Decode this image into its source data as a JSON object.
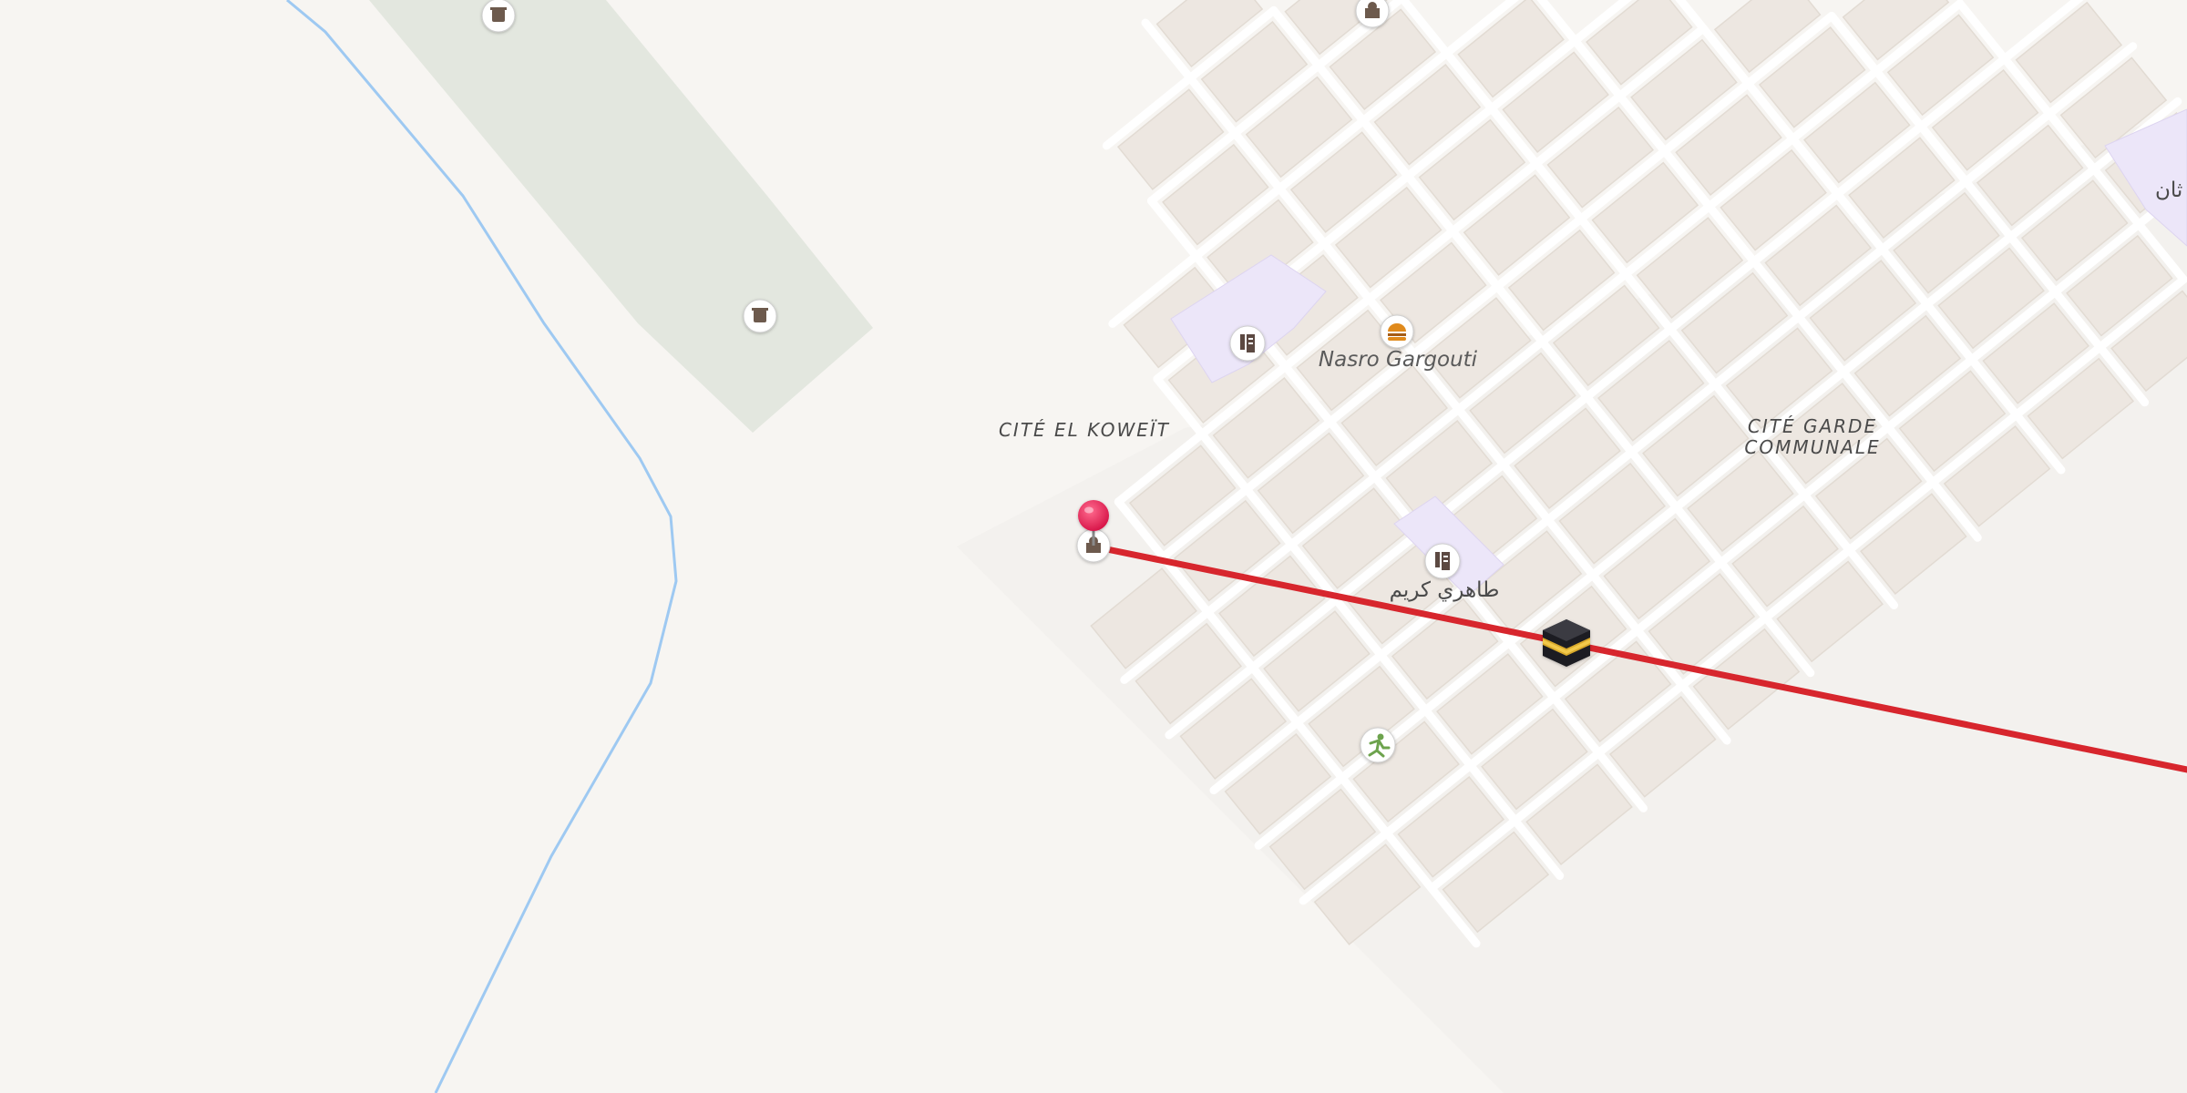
{
  "map": {
    "labels": {
      "cite_el_koweit": "CITÉ EL KOWEÏT",
      "cite_garde_line1": "CITÉ GARDE",
      "cite_garde_line2": "COMMUNALE",
      "nasro_gargouti": "Nasro Gargouti",
      "arabic_school": "طاهري كريم",
      "arabic_edge": "ثان"
    },
    "markers": {
      "pin": "location-pin",
      "kaaba": "kaaba-icon"
    },
    "colors": {
      "background": "#f7f5f2",
      "block": "#efe9e3",
      "road": "#ffffff",
      "river": "#9ec9f2",
      "cemetery": "#e3e6df",
      "school_area": "#ece6f9",
      "route": "#d7262d",
      "pin": "#e8245a"
    }
  }
}
